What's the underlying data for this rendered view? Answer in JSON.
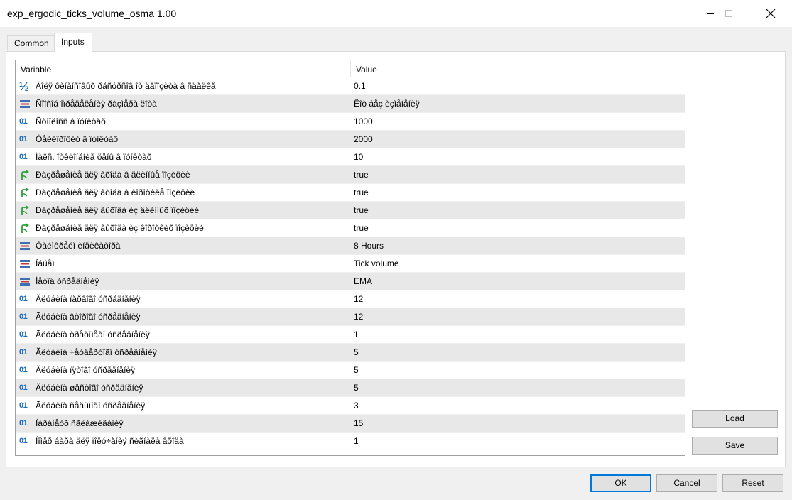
{
  "window": {
    "title": "exp_ergodic_ticks_volume_osma 1.00"
  },
  "tabs": [
    {
      "label": "Common"
    },
    {
      "label": "Inputs"
    }
  ],
  "grid": {
    "header": {
      "variable": "Variable",
      "value": "Value"
    },
    "rows": [
      {
        "icon": "fraction-icon",
        "name": "Äîëÿ ôèíàíñîâûõ ðåñóðñîâ îò äåïîçèòà â ñäåëêå",
        "value": "0.1"
      },
      {
        "icon": "enum-icon",
        "name": "Ñïîñîá îïðåäåëåíèÿ ðàçìåðà ëîòà",
        "value": "Ëîò áåç èçìåíåíèÿ"
      },
      {
        "icon": "int-icon",
        "name": "Ñòîïëîññ â ïóíêòàõ",
        "value": "1000"
      },
      {
        "icon": "int-icon",
        "name": "Òåéêïðîôèò â ïóíêòàõ",
        "value": "2000"
      },
      {
        "icon": "int-icon",
        "name": "Ìàêñ. îòêëîíåíèå öåíû â ïóíêòàõ",
        "value": "10"
      },
      {
        "icon": "bool-icon",
        "name": "Ðàçðåøåíèå äëÿ âõîäà â äëèííûå ïîçèöèè",
        "value": "true"
      },
      {
        "icon": "bool-icon",
        "name": "Ðàçðåøåíèå äëÿ âõîäà â êîðîòêèå ïîçèöèè",
        "value": "true"
      },
      {
        "icon": "bool-icon",
        "name": "Ðàçðåøåíèå äëÿ âûõîäà èç äëèííûõ ïîçèöèé",
        "value": "true"
      },
      {
        "icon": "bool-icon",
        "name": "Ðàçðåøåíèå äëÿ âûõîäà èç êîðîòêèõ ïîçèöèé",
        "value": "true"
      },
      {
        "icon": "enum-icon",
        "name": "Òàéìôðåéì èíäèêàòîðà",
        "value": "8 Hours"
      },
      {
        "icon": "enum-icon",
        "name": "Îáúåì",
        "value": "Tick volume"
      },
      {
        "icon": "enum-icon",
        "name": "Ìåòîä óñðåäíåíèÿ",
        "value": "EMA"
      },
      {
        "icon": "int-icon",
        "name": "Ãëóáèíà ïåðâîãî óñðåäíåíèÿ",
        "value": "12"
      },
      {
        "icon": "int-icon",
        "name": "Ãëóáèíà âòîðîãî óñðåäíåíèÿ",
        "value": "12"
      },
      {
        "icon": "int-icon",
        "name": "Ãëóáèíà òðåòüåãî óñðåäíåíèÿ",
        "value": "1"
      },
      {
        "icon": "int-icon",
        "name": "Ãëóáèíà ÷åòâåðòîãî óñðåäíåíèÿ",
        "value": "5"
      },
      {
        "icon": "int-icon",
        "name": "Ãëóáèíà ïÿòîãî óñðåäíåíèÿ",
        "value": "5"
      },
      {
        "icon": "int-icon",
        "name": "Ãëóáèíà øåñòîãî óñðåäíåíèÿ",
        "value": "5"
      },
      {
        "icon": "int-icon",
        "name": "Ãëóáèíà ñåäüìîãî óñðåäíåíèÿ",
        "value": "3"
      },
      {
        "icon": "int-icon",
        "name": "Ïàðàìåòð ñãëàæèâàíèÿ",
        "value": "15"
      },
      {
        "icon": "int-icon",
        "name": "Íîìåð áàðà äëÿ ïîëó÷åíèÿ ñèãíàëà âõîäà",
        "value": "1"
      }
    ]
  },
  "side_buttons": {
    "load": "Load",
    "save": "Save"
  },
  "footer": {
    "ok": "OK",
    "cancel": "Cancel",
    "reset": "Reset"
  },
  "colors": {
    "accent": "#0078d7",
    "int_icon": "#1e6bb8",
    "bool_icon": "#2e9e3e",
    "enum_icon": "#3d6fb5"
  }
}
